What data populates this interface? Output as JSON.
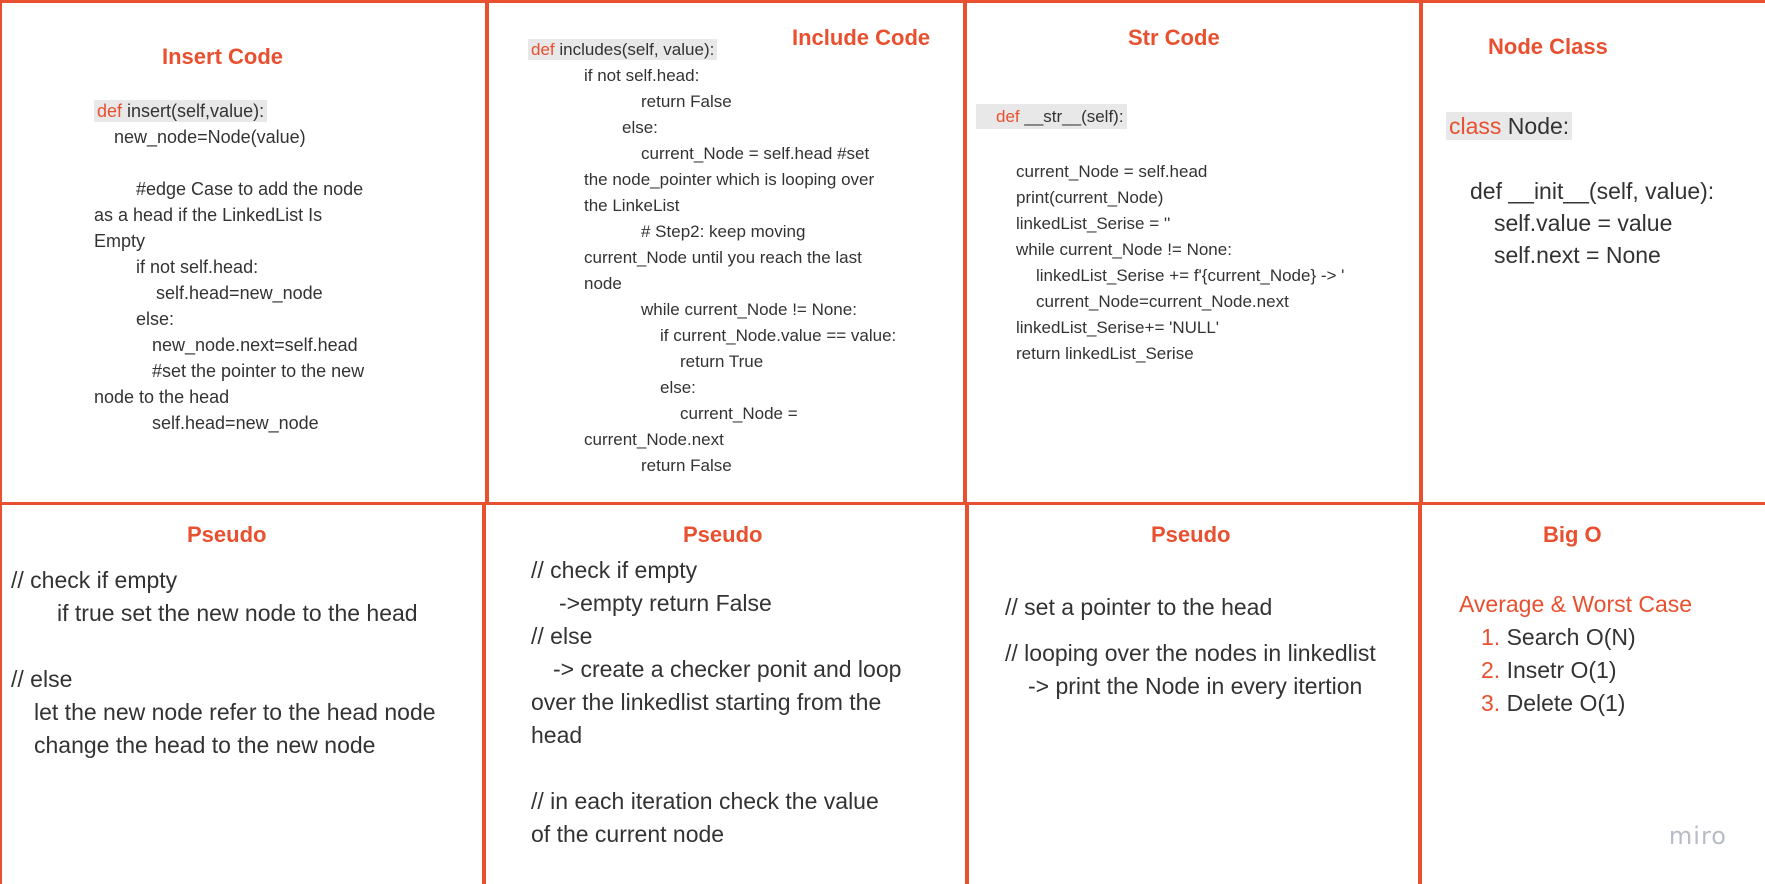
{
  "frames": {
    "insert_code": {
      "title": "Insert Code",
      "def_kw": "def",
      "def_rest": " insert(self,value):",
      "lines": [
        "new_node=Node(value)",
        "",
        "#edge Case to add the node",
        "as  a head if the LinkedList Is",
        "Empty",
        "if not self.head:",
        "self.head=new_node",
        "else:",
        "new_node.next=self.head",
        "#set the pointer to the new",
        "node to the head",
        "self.head=new_node"
      ]
    },
    "include_code": {
      "title": "Include Code",
      "def_kw": "def",
      "def_rest": " includes(self, value):",
      "lines": [
        "if not self.head:",
        "return False",
        "else:",
        "current_Node = self.head        #set",
        "the node_pointer which is looping over",
        "the LinkeList",
        "# Step2: keep moving",
        "current_Node until you reach the last",
        "node",
        "while current_Node != None:",
        "if current_Node.value == value:",
        "return True",
        "else:",
        "current_Node =",
        "current_Node.next",
        "return False"
      ]
    },
    "str_code": {
      "title": "Str Code",
      "def_kw": "def",
      "def_rest": " __str__(self):",
      "lines": [
        "current_Node = self.head",
        "print(current_Node)",
        "linkedList_Serise = ''",
        "while current_Node != None:",
        "linkedList_Serise += f'{current_Node} -> '",
        "current_Node=current_Node.next",
        "linkedList_Serise+= 'NULL'",
        "return linkedList_Serise"
      ]
    },
    "node_class": {
      "title": "Node Class",
      "class_kw": "class",
      "class_rest": " Node:",
      "lines": [
        "def __init__(self, value):",
        "self.value = value",
        "self.next = None"
      ]
    },
    "pseudo_insert": {
      "title": "Pseudo",
      "lines": [
        "// check if empty",
        "if true set the new node to the head",
        "",
        "// else",
        "let the new node refer to the head node",
        "change the head to the new node"
      ]
    },
    "pseudo_include": {
      "title": "Pseudo",
      "lines": [
        "// check if empty",
        "->empty return False",
        "// else",
        "-> create a checker ponit and loop",
        "over the linkedlist starting from the",
        "head",
        "",
        "// in each iteration check the value",
        "of the current node"
      ]
    },
    "pseudo_str": {
      "title": "Pseudo",
      "lines": [
        "// set a pointer to the head",
        "// looping over the nodes in linkedlist",
        "-> print the Node in every itertion"
      ]
    },
    "big_o": {
      "title": "Big O",
      "subtitle": "Average & Worst Case",
      "items": [
        {
          "num": "1.",
          "text": "Search O(N)"
        },
        {
          "num": "2.",
          "text": "Insetr O(1)"
        },
        {
          "num": "3.",
          "text": "Delete O(1)"
        }
      ]
    }
  },
  "watermark": "miro",
  "colors": {
    "accent": "#e8502f",
    "text": "#333333",
    "highlight": "#e8e8e8",
    "watermark": "#b7bcc8"
  }
}
